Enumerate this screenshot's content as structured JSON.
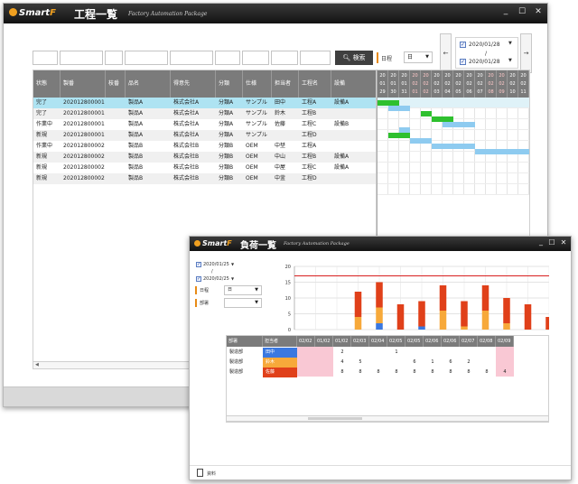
{
  "main_window": {
    "logo_prefix": "Smart",
    "logo_suffix": "F",
    "title": "工程一覧",
    "subtitle": "Factory Automation Package",
    "controls": {
      "minimize": "_",
      "maximize": "☐",
      "close": "✕"
    },
    "search_button": "検索",
    "search_icon": "magnifier-icon",
    "schedule_label": "日程",
    "unit_select": "日",
    "date_from": "2020/01/28",
    "date_sep": "/",
    "date_to": "2020/01/28",
    "prev_arrow": "←",
    "next_arrow": "→",
    "table": {
      "columns": [
        "状態",
        "製番",
        "枝番",
        "品名",
        "得意先",
        "分類",
        "仕様",
        "担当者",
        "工程名",
        "設備"
      ],
      "rows": [
        [
          "完了",
          "202012800001",
          "",
          "製品A",
          "株式会社A",
          "分類A",
          "サンプル",
          "田中",
          "工程A",
          "設備A"
        ],
        [
          "完了",
          "202012800001",
          "",
          "製品A",
          "株式会社A",
          "分類A",
          "サンプル",
          "鈴木",
          "工程B",
          ""
        ],
        [
          "作業中",
          "202012800001",
          "",
          "製品A",
          "株式会社A",
          "分類A",
          "サンプル",
          "佐藤",
          "工程C",
          "設備B"
        ],
        [
          "新規",
          "202012800001",
          "",
          "製品A",
          "株式会社A",
          "分類A",
          "サンプル",
          "",
          "工程D",
          ""
        ],
        [
          "作業中",
          "202012800002",
          "",
          "製品B",
          "株式会社B",
          "分類B",
          "OEM",
          "中埜",
          "工程A",
          ""
        ],
        [
          "新規",
          "202012800002",
          "",
          "製品B",
          "株式会社B",
          "分類B",
          "OEM",
          "中山",
          "工程B",
          "設備A"
        ],
        [
          "新規",
          "202012800002",
          "",
          "製品B",
          "株式会社B",
          "分類B",
          "OEM",
          "中屋",
          "工程C",
          "設備A"
        ],
        [
          "新規",
          "202012800002",
          "",
          "製品B",
          "株式会社B",
          "分類B",
          "OEM",
          "中釜",
          "工程D",
          ""
        ]
      ]
    },
    "gantt": {
      "dates": [
        [
          "20",
          "01",
          "29"
        ],
        [
          "20",
          "01",
          "30"
        ],
        [
          "20",
          "01",
          "31"
        ],
        [
          "20",
          "02",
          "01"
        ],
        [
          "20",
          "02",
          "02"
        ],
        [
          "20",
          "02",
          "03"
        ],
        [
          "20",
          "02",
          "04"
        ],
        [
          "20",
          "02",
          "05"
        ],
        [
          "20",
          "02",
          "06"
        ],
        [
          "20",
          "02",
          "07"
        ],
        [
          "20",
          "02",
          "08"
        ],
        [
          "20",
          "02",
          "09"
        ],
        [
          "20",
          "02",
          "10"
        ],
        [
          "20",
          "02",
          "11"
        ]
      ],
      "weekend_indices": [
        3,
        4,
        10,
        11
      ],
      "bars": [
        {
          "row": 0,
          "start": 0,
          "len": 2,
          "color": "#2ec02e"
        },
        {
          "row": 1,
          "start": 1,
          "len": 2,
          "color": "#8ecbf0"
        },
        {
          "row": 2,
          "start": 4,
          "len": 1,
          "color": "#2ec02e"
        },
        {
          "row": 3,
          "start": 5,
          "len": 1,
          "color": "#8ecbf0"
        },
        {
          "row": 3,
          "start": 5,
          "len": 2,
          "color": "#2ec02e"
        },
        {
          "row": 4,
          "start": 6,
          "len": 3,
          "color": "#8ecbf0"
        },
        {
          "row": 5,
          "start": 2,
          "len": 1,
          "color": "#8ecbf0"
        },
        {
          "row": 6,
          "start": 1,
          "len": 2,
          "color": "#2ec02e"
        },
        {
          "row": 7,
          "start": 3,
          "len": 2,
          "color": "#8ecbf0"
        },
        {
          "row": 8,
          "start": 5,
          "len": 4,
          "color": "#8ecbf0"
        },
        {
          "row": 9,
          "start": 9,
          "len": 5,
          "color": "#8ecbf0"
        }
      ]
    }
  },
  "load_window": {
    "logo_prefix": "Smart",
    "logo_suffix": "F",
    "title": "負荷一覧",
    "subtitle": "Factory Automation Package",
    "controls": {
      "minimize": "_",
      "maximize": "☐",
      "close": "✕"
    },
    "date_from": "2020/01/25",
    "date_sep": "/",
    "date_to": "2020/02/25",
    "schedule_label": "日程",
    "unit_select": "日",
    "dept_label": "部署",
    "footer_icon": "document-icon",
    "footer_label": "資料",
    "table": {
      "columns": [
        "部署",
        "担当者",
        "02/02",
        "01/02",
        "01/02",
        "02/03",
        "02/04",
        "02/05",
        "02/05",
        "02/06",
        "02/06",
        "02/07",
        "02/08",
        "02/09"
      ],
      "rows": [
        {
          "dept": "製造部",
          "person": "田中",
          "color": "#3a78e0",
          "values": [
            "",
            "",
            "2",
            "",
            "",
            "1",
            "",
            "",
            "",
            "",
            "",
            ""
          ]
        },
        {
          "dept": "製造部",
          "person": "鈴木",
          "color": "#f7a93a",
          "values": [
            "",
            "",
            "4",
            "5",
            "",
            "",
            "6",
            "1",
            "6",
            "2",
            "",
            ""
          ]
        },
        {
          "dept": "製造部",
          "person": "佐藤",
          "color": "#e0401a",
          "values": [
            "",
            "",
            "8",
            "8",
            "8",
            "8",
            "8",
            "8",
            "8",
            "8",
            "8",
            "4"
          ]
        }
      ],
      "pink_columns": [
        0,
        1,
        11
      ]
    }
  },
  "chart_data": {
    "type": "bar",
    "stacked": true,
    "categories": [
      "02/02",
      "01/02",
      "01/02",
      "02/03",
      "02/04",
      "02/05",
      "02/05",
      "02/06",
      "02/06",
      "02/07",
      "02/08",
      "02/09"
    ],
    "series": [
      {
        "name": "田中",
        "color": "#3a78e0",
        "values": [
          0,
          0,
          0,
          2,
          0,
          1,
          0,
          0,
          0,
          0,
          0,
          0
        ]
      },
      {
        "name": "鈴木",
        "color": "#f7a93a",
        "values": [
          0,
          0,
          4,
          5,
          0,
          0,
          6,
          1,
          6,
          2,
          0,
          0
        ]
      },
      {
        "name": "佐藤",
        "color": "#e0401a",
        "values": [
          0,
          0,
          8,
          8,
          8,
          8,
          8,
          8,
          8,
          8,
          8,
          4
        ]
      }
    ],
    "capacity_line": 17,
    "capacity_color": "#d82020",
    "yticks": [
      0,
      5,
      10,
      15,
      20
    ],
    "ylim": [
      0,
      20
    ],
    "grid": true
  }
}
